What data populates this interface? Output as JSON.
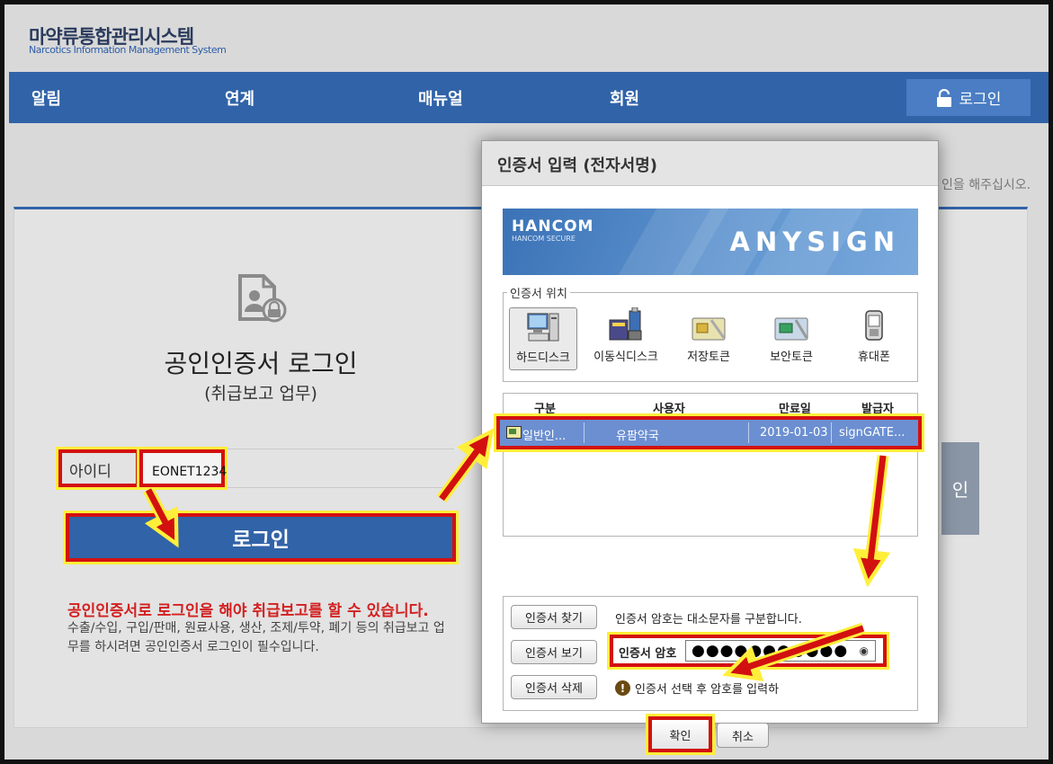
{
  "header": {
    "logo_kr": "마약류통합관리시스템",
    "logo_en": "Narcotics Information Management System"
  },
  "nav": {
    "items": [
      "알림",
      "연계",
      "매뉴얼",
      "회원"
    ],
    "login_label": "로그인"
  },
  "page": {
    "notice_partial": "인을 해주십시오.",
    "cert_title": "공인인증서 로그인",
    "cert_subtitle": "(취급보고 업무)",
    "id_label": "아이디",
    "id_value": "EONET1234",
    "login_button": "로그인",
    "warning_title": "공인인증서로 로그인을 해야 취급보고를 할 수 있습니다.",
    "warning_desc": "수출/수입, 구입/판매, 원료사용, 생산, 조제/투약, 폐기 등의 취급보고 업무를 하시려면 공인인증서 로그인이 필수입니다.",
    "ghost_button_partial": "인"
  },
  "dialog": {
    "title": "인증서 입력 (전자서명)",
    "banner": {
      "brand": "HANCOM",
      "brand_sub": "HANCOM SECURE",
      "product": "ANYSIGN"
    },
    "location_legend": "인증서 위치",
    "locations": [
      "하드디스크",
      "이동식디스크",
      "저장토큰",
      "보안토큰",
      "휴대폰"
    ],
    "columns": [
      "구분",
      "사용자",
      "만료일",
      "발급자"
    ],
    "cert_row": {
      "type": "일반인...",
      "user": "유팜약국",
      "expiry": "2019-01-03",
      "issuer": "signGATE..."
    },
    "btn_find": "인증서 찾기",
    "btn_view": "인증서 보기",
    "btn_delete": "인증서 삭제",
    "hint_case": "인증서 암호는 대소문자를 구분합니다.",
    "pw_label": "인증서 암호",
    "pw_value": "●●●●●●●●●●●",
    "hint_select": "인증서 선택 후 암호를 입력하",
    "ok": "확인",
    "cancel": "취소"
  },
  "colors": {
    "nav_blue": "#3163a8",
    "highlight_red": "#d31010",
    "highlight_yellow": "#ffef3a",
    "warning_red": "#d32020",
    "selected_row": "#6b8fd1"
  }
}
